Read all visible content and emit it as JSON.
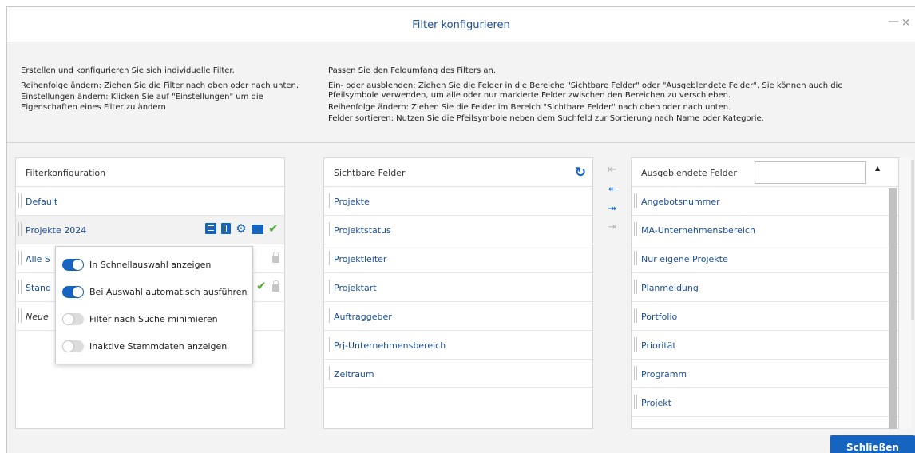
{
  "dialog": {
    "title": "Filter konfigurieren"
  },
  "window": {
    "min": "—",
    "close": "×"
  },
  "info_left": {
    "head": "Erstellen und konfigurieren Sie sich individuelle Filter.",
    "order_key": "Reihenfolge ändern:",
    "order_text": " Ziehen Sie die Filter nach oben oder nach unten.",
    "settings_key": "Einstellungen ändern:",
    "settings_text": " Klicken Sie auf \"Einstellungen\" um die Eigenschaften eines Filter zu ändern"
  },
  "info_right": {
    "head": "Passen Sie den Feldumfang des Filters an.",
    "show_key": "Ein- oder ausblenden:",
    "show_text": " Ziehen Sie die Felder in die Bereiche \"Sichtbare Felder\" oder \"Ausgeblendete Felder\". Sie können auch die Pfeilsymbole verwenden, um alle oder nur markierte Felder zwischen den Bereichen zu verschieben.",
    "order_key": "Reihenfolge ändern:",
    "order_text": " Ziehen Sie die Felder im Bereich \"Sichtbare Felder\" nach oben oder nach unten.",
    "sort_key": "Felder sortieren:",
    "sort_text": " Nutzen Sie die Pfeilsymbole neben dem Suchfeld zur Sortierung nach Name oder Kategorie."
  },
  "filter_panel": {
    "header": "Filterkonfiguration",
    "rows": [
      "Default",
      "Projekte 2024",
      "Alle S",
      "Stand",
      "Neue"
    ]
  },
  "visible_panel": {
    "header": "Sichtbare Felder",
    "reload_icon": "↻",
    "rows": [
      "Projekte",
      "Projektstatus",
      "Projektleiter",
      "Projektart",
      "Auftraggeber",
      "Prj-Unternehmensbereich",
      "Zeitraum"
    ]
  },
  "hidden_panel": {
    "header": "Ausgeblendete Felder",
    "search_value": "",
    "sort_icon": "▲",
    "rows": [
      "Angebotsnummer",
      "MA-Unternehmensbereich",
      "Nur eigene Projekte",
      "Planmeldung",
      "Portfolio",
      "Priorität",
      "Programm",
      "Projekt"
    ]
  },
  "arrows": {
    "move_selected_left": "⇤",
    "move_all_left": "⯬",
    "move_all_right": "⯮",
    "move_selected_right": "⇥"
  },
  "popup": {
    "toggles": [
      {
        "label": "In Schnellauswahl anzeigen",
        "on": true
      },
      {
        "label": "Bei Auswahl automatisch ausführen",
        "on": true
      },
      {
        "label": "Filter nach Suche minimieren",
        "on": false
      },
      {
        "label": "Inaktive Stammdaten anzeigen",
        "on": false
      }
    ]
  },
  "footer": {
    "close_label": "Schließen"
  },
  "colors": {
    "accent": "#1565c0",
    "title": "#1b4f96",
    "check": "#53a83a"
  }
}
